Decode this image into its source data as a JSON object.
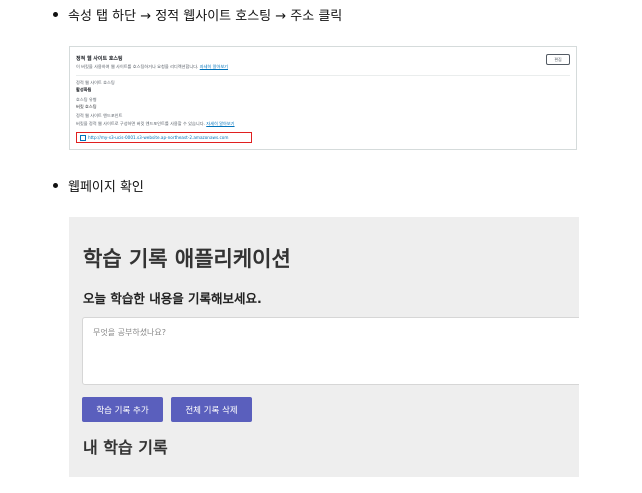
{
  "steps": [
    {
      "text": "속성 탭 하단 → 정적 웹사이트 호스팅 → 주소 클릭"
    },
    {
      "text": "웹페이지 확인"
    }
  ],
  "console": {
    "title": "정적 웹 사이트 호스팅",
    "description": "이 버킷을 사용하여 웹 사이트를 호스팅하거나 요청을 리디렉션합니다.",
    "description_link": "자세히 알아보기",
    "edit_label": "편집",
    "rows": [
      {
        "label": "정적 웹 사이트 호스팅",
        "value": "활성화됨"
      },
      {
        "label": "호스팅 유형",
        "value": "버킷 호스팅"
      },
      {
        "label": "정적 웹 사이트 엔드포인트",
        "value": ""
      }
    ],
    "endpoint_note": "버킷을 정적 웹 사이트로 구성하면 버킷 엔드포인트를 사용할 수 있습니다.",
    "endpoint_note_link": "자세히 알아보기",
    "endpoint_url": "http://my-s3-ucis-0001.s3-website.ap-northeast-2.amazonaws.com"
  },
  "webapp": {
    "title": "학습 기록 애플리케이션",
    "subtitle": "오늘 학습한 내용을 기록해보세요.",
    "textarea_placeholder": "무엇을 공부하셨나요?",
    "add_button": "학습 기록 추가",
    "delete_button": "전체 기록 삭제",
    "list_title": "내 학습 기록"
  },
  "colors": {
    "button": "#5a5fbd",
    "webapp_bg": "#eeeeee",
    "highlight": "#e02020",
    "link": "#0073bb"
  }
}
